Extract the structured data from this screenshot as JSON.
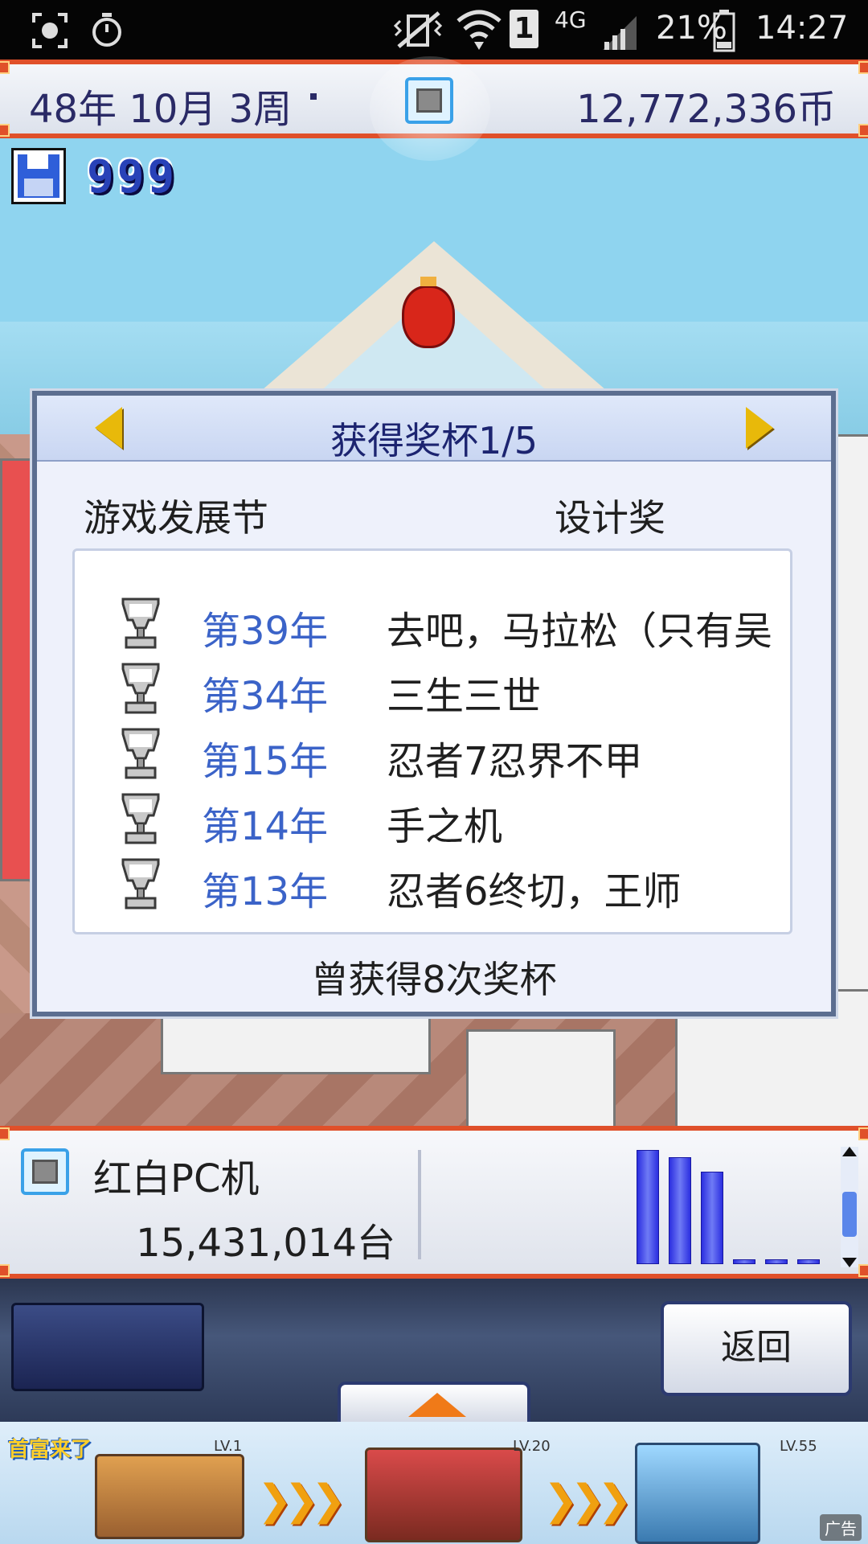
{
  "status_bar": {
    "network": "4G",
    "sim": "1",
    "battery": "21%",
    "time": "14:27"
  },
  "top_bar": {
    "date": "48年 10月 3周",
    "money": "12,772,336币"
  },
  "points": "999",
  "dialog": {
    "title": "获得奖杯1/5",
    "event": "游戏发展节",
    "category": "设计奖",
    "trophies": [
      {
        "year": "第39年",
        "name": "去吧，马拉松（只有吴街"
      },
      {
        "year": "第34年",
        "name": "三生三世"
      },
      {
        "year": "第15年",
        "name": "忍者7忍界不甲"
      },
      {
        "year": "第14年",
        "name": "手之机"
      },
      {
        "year": "第13年",
        "name": "忍者6终切，王师"
      }
    ],
    "total": "曾获得8次奖杯"
  },
  "console_panel": {
    "name": "红白PC机",
    "units": "15,431,014台",
    "bars": [
      1.0,
      0.94,
      0.81,
      0.04,
      0.04,
      0.04
    ]
  },
  "controls": {
    "back_label": "返回"
  },
  "ad": {
    "logo": "首富来了",
    "levels": [
      "LV.1",
      "LV.20",
      "LV.55"
    ],
    "tag": "广告"
  },
  "colors": {
    "accent_border": "#e0502a",
    "year_text": "#3b63c8",
    "title_text": "#1c2470",
    "bar_fill": "#2b2ee0"
  }
}
